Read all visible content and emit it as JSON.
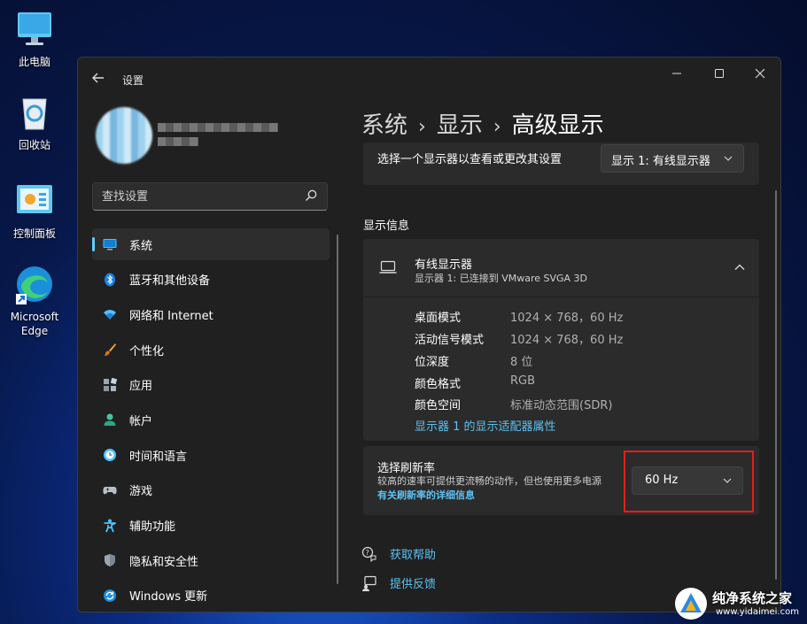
{
  "desktop": {
    "icons": [
      {
        "label": "此电脑"
      },
      {
        "label": "回收站"
      },
      {
        "label": "控制面板"
      },
      {
        "label": "Microsoft Edge"
      }
    ]
  },
  "window": {
    "app_title": "设置",
    "controls": {
      "minimize": "—",
      "maximize": "☐",
      "close": "✕"
    }
  },
  "search": {
    "placeholder": "查找设置"
  },
  "sidebar": {
    "items": [
      {
        "label": "系统",
        "icon": "system-icon",
        "active": true
      },
      {
        "label": "蓝牙和其他设备",
        "icon": "bluetooth-icon"
      },
      {
        "label": "网络和 Internet",
        "icon": "wifi-icon"
      },
      {
        "label": "个性化",
        "icon": "brush-icon"
      },
      {
        "label": "应用",
        "icon": "apps-icon"
      },
      {
        "label": "帐户",
        "icon": "account-icon"
      },
      {
        "label": "时间和语言",
        "icon": "clock-globe-icon"
      },
      {
        "label": "游戏",
        "icon": "gamepad-icon"
      },
      {
        "label": "辅助功能",
        "icon": "accessibility-icon"
      },
      {
        "label": "隐私和安全性",
        "icon": "shield-icon"
      },
      {
        "label": "Windows 更新",
        "icon": "update-icon"
      }
    ]
  },
  "breadcrumb": {
    "level1": "系统",
    "level2": "显示",
    "level3": "高级显示",
    "separator": "›"
  },
  "display_select": {
    "label": "选择一个显示器以查看或更改其设置",
    "value": "显示 1: 有线显示器"
  },
  "display_info": {
    "section_title": "显示信息",
    "monitor_name": "有线显示器",
    "monitor_desc": "显示器 1: 已连接到 VMware SVGA 3D",
    "rows": [
      {
        "key": "桌面模式",
        "value": "1024 × 768，60 Hz"
      },
      {
        "key": "活动信号模式",
        "value": "1024 × 768，60 Hz"
      },
      {
        "key": "位深度",
        "value": "8 位"
      },
      {
        "key": "颜色格式",
        "value": "RGB"
      },
      {
        "key": "颜色空间",
        "value": "标准动态范围(SDR)"
      }
    ],
    "adapter_link": "显示器 1 的显示适配器属性"
  },
  "refresh": {
    "title": "选择刷新率",
    "desc": "较高的速率可提供更流畅的动作，但也使用更多电源",
    "link": "有关刷新率的详细信息",
    "value": "60 Hz"
  },
  "help": {
    "get_help": "获取帮助",
    "feedback": "提供反馈"
  },
  "watermark": {
    "name": "纯净系统之家",
    "url": "www.yidaimei.com"
  },
  "colors": {
    "accent": "#60cdff",
    "link": "#5cc2f2",
    "highlight_box": "#e21f1f",
    "window_bg": "#202020",
    "card_bg": "#2b2b2b"
  }
}
